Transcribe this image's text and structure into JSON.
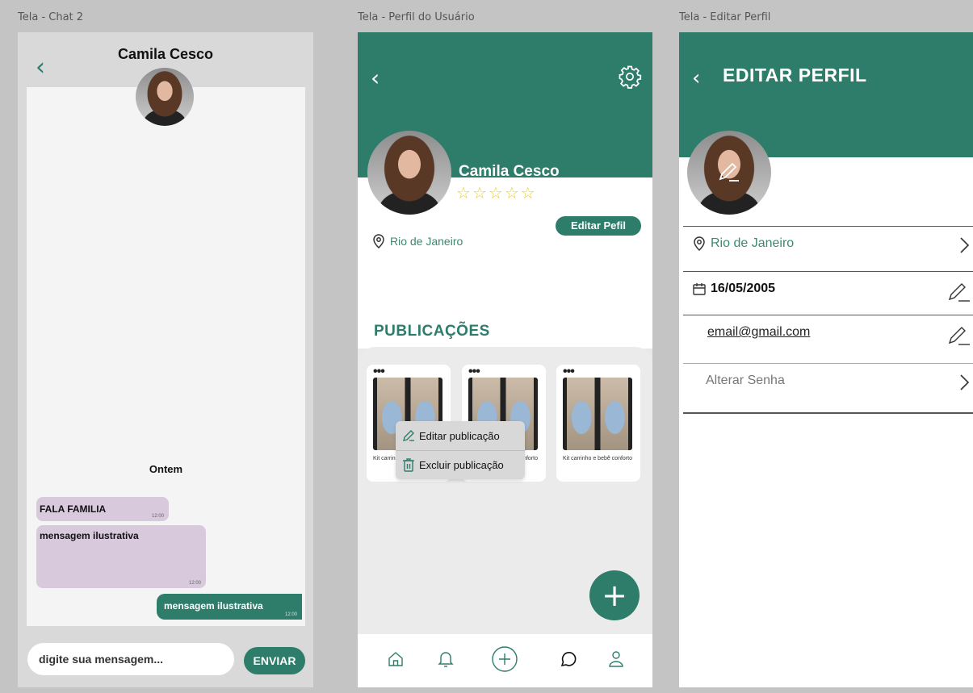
{
  "frames": {
    "chat_label": "Tela - Chat 2",
    "profile_label": "Tela - Perfil do Usuário",
    "edit_label": "Tela - Editar Perfil"
  },
  "chat": {
    "contact_name": "Camila Cesco",
    "day_separator": "Ontem",
    "messages": [
      {
        "text": "FALA FAMILIA",
        "time": "12:00",
        "side": "received"
      },
      {
        "text": "mensagem ilustrativa",
        "time": "12:00",
        "side": "received"
      },
      {
        "text": "mensagem ilustrativa",
        "time": "12:00",
        "side": "sent"
      }
    ],
    "input_placeholder": "digite sua mensagem...",
    "send_label": "ENVIAR"
  },
  "profile": {
    "name": "Camila Cesco",
    "rating_stars": 5,
    "edit_label": "Editar Pefil",
    "location": "Rio de Janeiro",
    "section_title": "PUBLICAÇÕES",
    "dots": "•••",
    "publications": [
      {
        "title": "Kit carrinho e bebê conforto"
      },
      {
        "title": "Kit carrinho e bebê conforto"
      },
      {
        "title": "Kit carrinho e bebê conforto"
      }
    ],
    "context_menu": {
      "edit_label": "Editar publicação",
      "delete_label": "Excluir publicação"
    },
    "fab_label": "+"
  },
  "edit_profile": {
    "title": "EDITAR PERFIL",
    "name": "Camila Cesco",
    "location": "Rio de Janeiro",
    "birth_date": "16/05/2005",
    "email": "email@gmail.com",
    "change_password": "Alterar Senha"
  },
  "colors": {
    "primary": "#2e7d6b",
    "received_bubble": "#d8c9dd",
    "star": "#e6cf3a"
  }
}
